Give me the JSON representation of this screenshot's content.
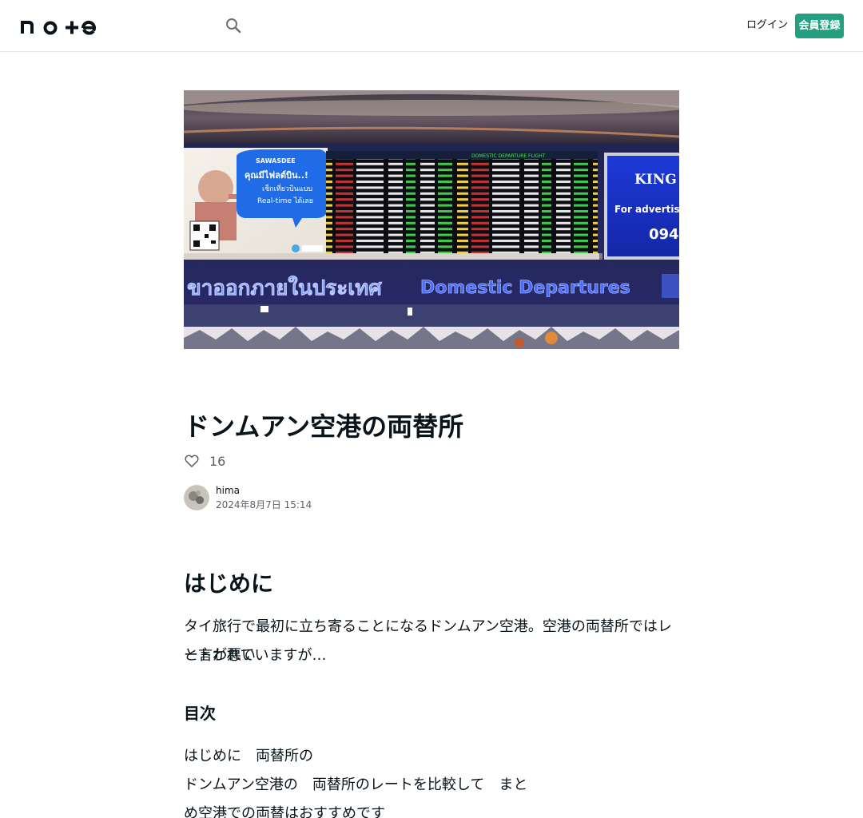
{
  "header": {
    "logo_text": "note",
    "login_label": "ログイン",
    "signup_label": "会員登録"
  },
  "hero": {
    "ad_brand": "SAWASDEE",
    "ad_text_line1": "คุณมีไฟลต์บิน..!",
    "ad_text_line2": "เช็กเที่ยวบินแบบ",
    "ad_text_line3": "Real-time ได้เลย",
    "board_title": "DOMESTIC DEPARTURE FLIGHT",
    "right_ad_brand": "KING",
    "right_ad_text": "For advertis",
    "right_ad_number": "094",
    "sign_thai": "ขาออกภายในประเทศ",
    "sign_english": "Domestic Departures"
  },
  "article": {
    "title": "ドンムアン空港の両替所",
    "like_count": "16",
    "author_name": "hima",
    "post_date": "2024年8月7日 15:14",
    "section1_heading": "はじめに",
    "section1_text_line1": "タイ旅行で最初に立ち寄ることになるドンムアン空港。空港の両替所ではレートが悪い",
    "section1_text_line2": "と言われていますが…",
    "section2_heading": "目次",
    "toc_line1": "はじめに　両替所の",
    "toc_line2": "ドンムアン空港の　両替所のレートを比較して　まと",
    "toc_line3": "め空港での両替はおすすめです"
  },
  "colors": {
    "accent": "#249f80",
    "text": "#08131a",
    "subtext": "#5a6066"
  },
  "icons": {
    "search": "search-icon",
    "like": "heart-icon"
  }
}
